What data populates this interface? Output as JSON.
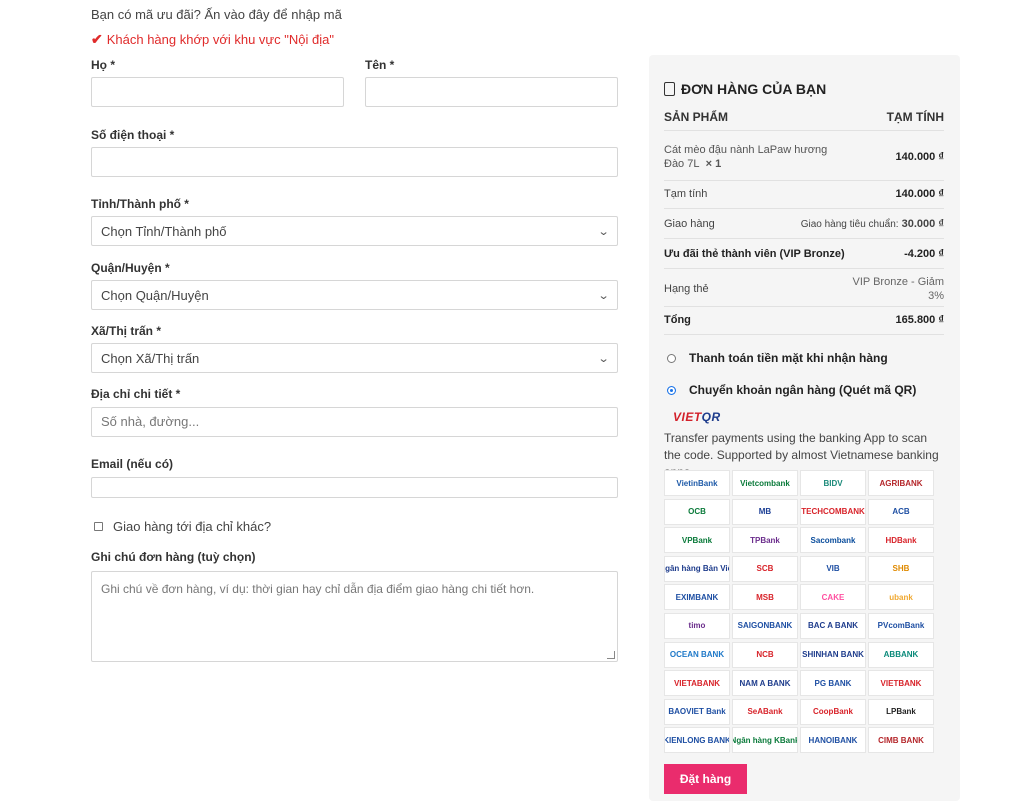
{
  "coupon_text": "Bạn có mã ưu đãi? Ấn vào đây để nhập mã",
  "region_notice": "Khách hàng khớp với khu vực \"Nội địa\"",
  "form": {
    "last_name_label": "Họ *",
    "first_name_label": "Tên *",
    "phone_label": "Số điện thoại *",
    "city_label": "Tỉnh/Thành phố *",
    "city_value": "Chọn Tỉnh/Thành phố",
    "district_label": "Quận/Huyện *",
    "district_value": "Chọn Quận/Huyện",
    "ward_label": "Xã/Thị trấn *",
    "ward_value": "Chọn Xã/Thị trấn",
    "address_label": "Địa chỉ chi tiết *",
    "address_placeholder": "Số nhà, đường...",
    "email_label": "Email (nếu có)",
    "ship_other_label": "Giao hàng tới địa chỉ khác?",
    "notes_label": "Ghi chú đơn hàng (tuỳ chọn)",
    "notes_placeholder": "Ghi chú về đơn hàng, ví dụ: thời gian hay chỉ dẫn địa điểm giao hàng chi tiết hơn."
  },
  "order": {
    "title": "ĐƠN HÀNG CỦA BẠN",
    "col_product": "SẢN PHẨM",
    "col_subtotal": "TẠM TÍNH",
    "product_name": "Cát mèo đậu nành LaPaw hương Đào 7L",
    "product_qty": "× 1",
    "product_price": "140.000 ₫",
    "subtotal_label": "Tạm tính",
    "subtotal_value": "140.000 ₫",
    "shipping_label": "Giao hàng",
    "shipping_method": "Giao hàng tiêu chuẩn:",
    "shipping_value": "30.000 ₫",
    "discount_label": "Ưu đãi thẻ thành viên (VIP Bronze)",
    "discount_value": "-4.200 ₫",
    "tier_label": "Hạng thẻ",
    "tier_value": "VIP Bronze - Giảm 3%",
    "total_label": "Tổng",
    "total_value": "165.800 ₫"
  },
  "payment": {
    "cod_label": "Thanh toán tiền mặt khi nhận hàng",
    "bank_label": "Chuyển khoản ngân hàng (Quét mã QR)",
    "vietqr_a": "VIET",
    "vietqr_b": "QR",
    "description": "Transfer payments using the banking App to scan the code. Supported by almost Vietnamese banking apps",
    "banks": [
      {
        "name": "VietinBank",
        "color": "#1e5aa8"
      },
      {
        "name": "Vietcombank",
        "color": "#0a7a3a"
      },
      {
        "name": "BIDV",
        "color": "#1b8a7a"
      },
      {
        "name": "AGRIBANK",
        "color": "#b4262a"
      },
      {
        "name": "OCB",
        "color": "#0a7a3a"
      },
      {
        "name": "MB",
        "color": "#1c3f95"
      },
      {
        "name": "TECHCOMBANK",
        "color": "#d8232a"
      },
      {
        "name": "ACB",
        "color": "#1e4fa3"
      },
      {
        "name": "VPBank",
        "color": "#0a7a3a"
      },
      {
        "name": "TPBank",
        "color": "#6b2d8c"
      },
      {
        "name": "Sacombank",
        "color": "#0a4d9c"
      },
      {
        "name": "HDBank",
        "color": "#d8232a"
      },
      {
        "name": "Ngân hàng Bản Việt",
        "color": "#1e3c8c"
      },
      {
        "name": "SCB",
        "color": "#d8232a"
      },
      {
        "name": "VIB",
        "color": "#1e4fa3"
      },
      {
        "name": "SHB",
        "color": "#e08a00"
      },
      {
        "name": "EXIMBANK",
        "color": "#1e4fa3"
      },
      {
        "name": "MSB",
        "color": "#d8232a"
      },
      {
        "name": "CAKE",
        "color": "#ff4fa0"
      },
      {
        "name": "ubank",
        "color": "#f0a830"
      },
      {
        "name": "timo",
        "color": "#6b2d8c"
      },
      {
        "name": "SAIGONBANK",
        "color": "#1e4fa3"
      },
      {
        "name": "BAC A BANK",
        "color": "#1e3c8c"
      },
      {
        "name": "PVcomBank",
        "color": "#1e4fa3"
      },
      {
        "name": "OCEAN BANK",
        "color": "#1e78c8"
      },
      {
        "name": "NCB",
        "color": "#d8232a"
      },
      {
        "name": "SHINHAN BANK",
        "color": "#1e3c8c"
      },
      {
        "name": "ABBANK",
        "color": "#0a8a7a"
      },
      {
        "name": "VIETABANK",
        "color": "#d8232a"
      },
      {
        "name": "NAM A BANK",
        "color": "#1e3c8c"
      },
      {
        "name": "PG BANK",
        "color": "#1e4fa3"
      },
      {
        "name": "VIETBANK",
        "color": "#d8232a"
      },
      {
        "name": "BAOVIET Bank",
        "color": "#1e4fa3"
      },
      {
        "name": "SeABank",
        "color": "#d8232a"
      },
      {
        "name": "CoopBank",
        "color": "#d8232a"
      },
      {
        "name": "LPBank",
        "color": "#222222"
      },
      {
        "name": "KIENLONG BANK",
        "color": "#1e4fa3"
      },
      {
        "name": "Ngân hàng KBank",
        "color": "#0a7a3a"
      },
      {
        "name": "HANOIBANK",
        "color": "#1e4fa3"
      },
      {
        "name": "CIMB BANK",
        "color": "#b4262a"
      }
    ]
  },
  "place_order_label": "Đặt hàng",
  "colors": {
    "accent": "#ea2c6d",
    "notice": "#e02b2b",
    "panel": "#f5f5f5"
  }
}
